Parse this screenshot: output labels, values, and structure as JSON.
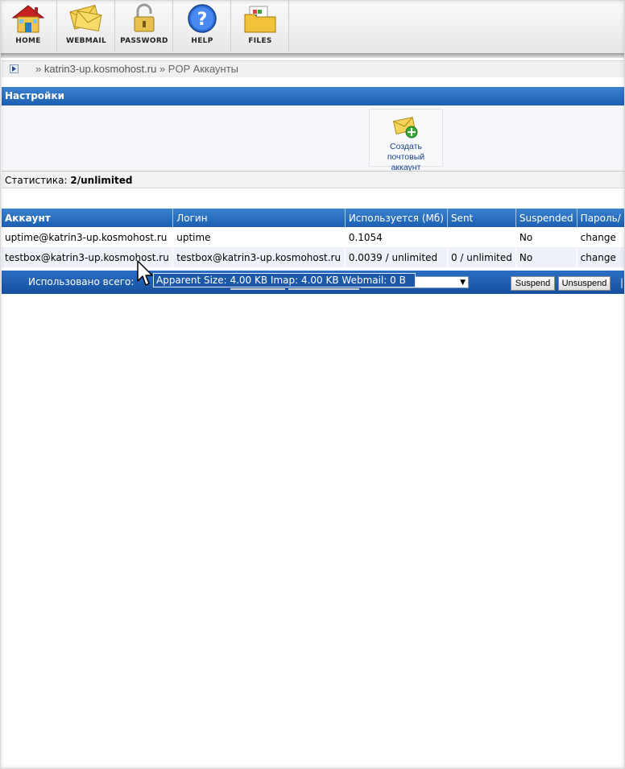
{
  "toolbar": {
    "items": [
      {
        "label": "HOME",
        "icon": "home-icon"
      },
      {
        "label": "WEBMAIL",
        "icon": "envelope-icon"
      },
      {
        "label": "PASSWORD",
        "icon": "lock-icon"
      },
      {
        "label": "HELP",
        "icon": "help-icon"
      },
      {
        "label": "FILES",
        "icon": "folder-icon"
      }
    ]
  },
  "breadcrumb": {
    "separator1": "»",
    "domain": "katrin3-up.kosmohost.ru",
    "separator2": "»",
    "page": "POP Аккаунты"
  },
  "section": {
    "title": "Настройки",
    "create_label_line1": "Создать",
    "create_label_line2": "почтовый",
    "create_label_line3": "аккаунт"
  },
  "stats": {
    "label": "Статистика:",
    "value": "2/unlimited"
  },
  "table": {
    "headers": [
      "Аккаунт",
      "Логин",
      "Используется (Мб)",
      "Sent",
      "Suspended",
      "Пароль/"
    ],
    "rows": [
      [
        "uptime@katrin3-up.kosmohost.ru",
        "uptime",
        "0.1054",
        "",
        "No",
        "change"
      ],
      [
        "testbox@katrin3-up.kosmohost.ru",
        "testbox@katrin3-up.kosmohost.ru",
        "0.0039 / unlimited",
        "0 / unlimited",
        "No",
        "change"
      ]
    ]
  },
  "footer": {
    "total_label": "Использовано всего:",
    "suspend_button": "Suspend",
    "unsuspend_button": "Unsuspend",
    "separator": "|"
  },
  "tooltip": {
    "text": "Apparent Size: 4.00 KB Imap: 4.00 KB Webmail: 0 B"
  },
  "colors": {
    "header_blue": "#1d5fb0",
    "link_blue": "#1a3f8a",
    "row_alt": "#eef2f8"
  }
}
